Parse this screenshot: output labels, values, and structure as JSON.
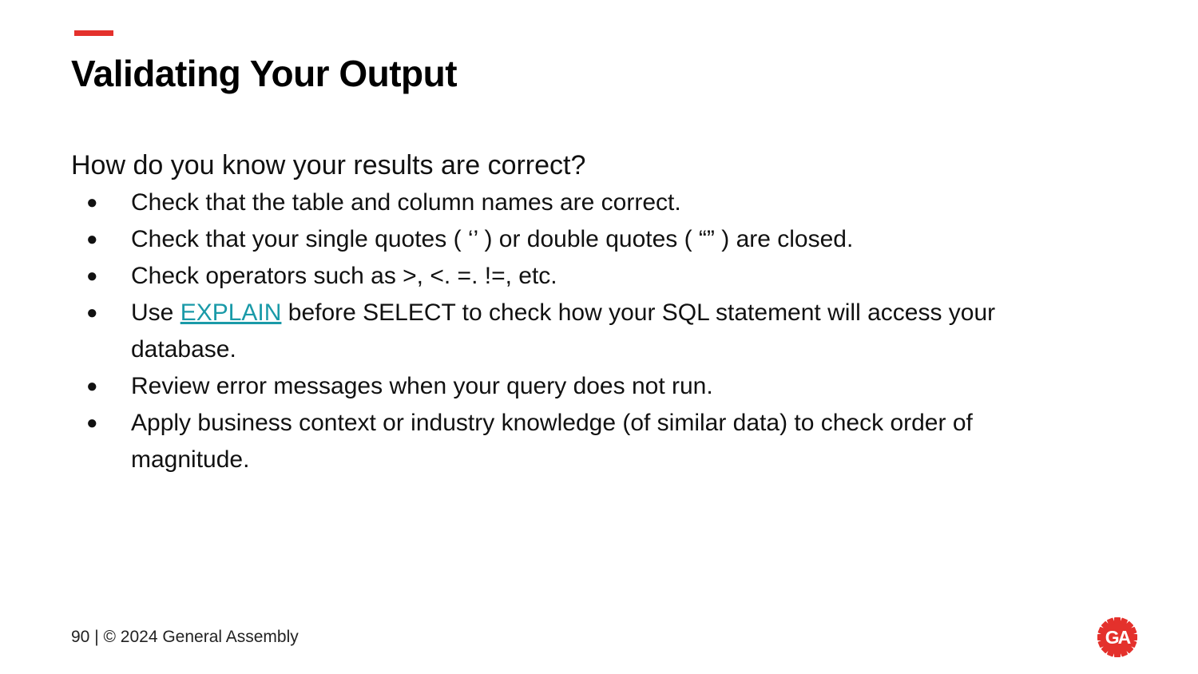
{
  "slide": {
    "title": "Validating Your Output",
    "intro": "How do you know your results are correct?",
    "bullets": [
      {
        "text": "Check that the table and column names are correct."
      },
      {
        "text": "Check that your single quotes ( ‘’ ) or double quotes ( “” ) are closed."
      },
      {
        "text": "Check operators such as >, <. =. !=, etc."
      },
      {
        "before": "Use ",
        "link": "EXPLAIN",
        "after": " before SELECT to check how your SQL statement will access your database."
      },
      {
        "text": "Review error messages when your query does not run."
      },
      {
        "text": "Apply business context or industry knowledge (of similar data) to check order of magnitude."
      }
    ],
    "bullet_glyph": "●"
  },
  "footer": {
    "text": "90 | © 2024 General Assembly"
  },
  "logo": {
    "icon": "general-assembly-gear-logo",
    "text": "GA"
  },
  "colors": {
    "accent": "#e4312c",
    "link": "#1a9aa8",
    "text": "#111111"
  }
}
